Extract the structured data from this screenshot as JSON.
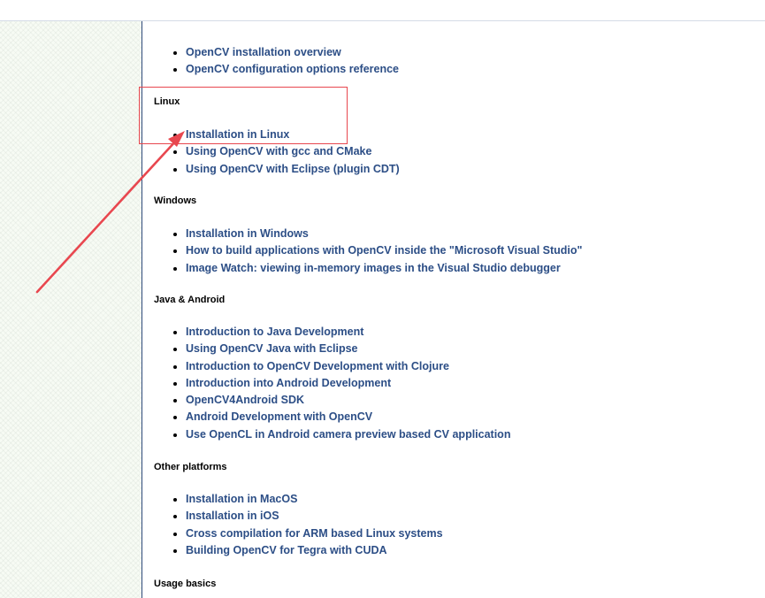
{
  "top_list": [
    "OpenCV installation overview",
    "OpenCV configuration options reference"
  ],
  "sections": [
    {
      "heading": "Linux",
      "links": [
        "Installation in Linux",
        "Using OpenCV with gcc and CMake",
        "Using OpenCV with Eclipse (plugin CDT)"
      ]
    },
    {
      "heading": "Windows",
      "links": [
        "Installation in Windows",
        "How to build applications with OpenCV inside the \"Microsoft Visual Studio\"",
        "Image Watch: viewing in-memory images in the Visual Studio debugger"
      ]
    },
    {
      "heading": "Java & Android",
      "links": [
        "Introduction to Java Development",
        "Using OpenCV Java with Eclipse",
        "Introduction to OpenCV Development with Clojure",
        "Introduction into Android Development",
        "OpenCV4Android SDK",
        "Android Development with OpenCV",
        "Use OpenCL in Android camera preview based CV application"
      ]
    },
    {
      "heading": "Other platforms",
      "links": [
        "Installation in MacOS",
        "Installation in iOS",
        "Cross compilation for ARM based Linux systems",
        "Building OpenCV for Tegra with CUDA"
      ]
    },
    {
      "heading": "Usage basics",
      "links": []
    }
  ],
  "colors": {
    "link": "#2c4e86",
    "annotation": "#e8474f",
    "content_border": "#2f4a7a"
  }
}
